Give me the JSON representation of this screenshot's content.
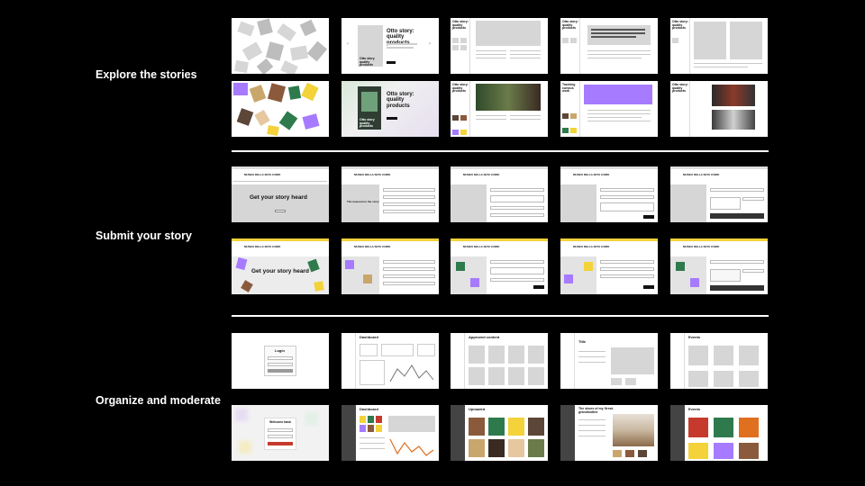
{
  "sections": [
    {
      "label": "Explore the stories"
    },
    {
      "label": "Submit your story"
    },
    {
      "label": "Organize and moderate"
    }
  ],
  "explore": {
    "carousel_title": "Otto story: quality products",
    "card_title": "Otto story quality products",
    "article_title": "Otto story: quality products",
    "tracking_title": "Tracking curious work"
  },
  "submit": {
    "hero_title": "Get your story heard",
    "brand": "MUSEO DELLA SETA COMO",
    "form_note": "The museum in the story"
  },
  "organize": {
    "login_title": "Login",
    "welcome_title": "Welcome back",
    "dashboard_title": "Dashboard",
    "approved_title": "Approved content",
    "uploaded_title": "Uploaded",
    "title_label": "Title",
    "content_label": "Content",
    "events_label": "Events",
    "story_title": "The shoes of my Great-grandmother"
  },
  "colors": {
    "background": "#000000",
    "accent_purple": "#a77bff",
    "accent_yellow": "#f3d23a",
    "accent_green": "#2f7a4d",
    "accent_red": "#c53a2c",
    "accent_orange": "#e07020"
  }
}
